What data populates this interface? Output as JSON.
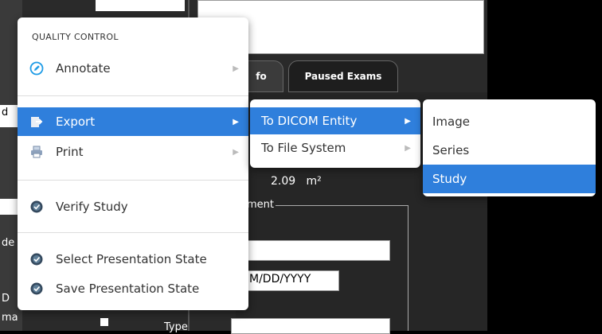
{
  "background": {
    "tabs": [
      {
        "label": "fo"
      },
      {
        "label": "Paused Exams"
      }
    ],
    "metric_value": "2.09",
    "metric_unit": "m²",
    "group_label": "ment",
    "date_placeholder": "M/DD/YYYY",
    "type_label": "Type",
    "left_fragments": [
      "d",
      "de",
      "D",
      "ma"
    ]
  },
  "context_menu": {
    "section_title": "QUALITY CONTROL",
    "items": [
      {
        "label": "Annotate",
        "icon": "annotate-icon",
        "has_submenu": true
      },
      {
        "label": "Export",
        "icon": "export-icon",
        "has_submenu": true,
        "highlighted": true
      },
      {
        "label": "Print",
        "icon": "printer-icon",
        "has_submenu": true
      },
      {
        "label": "Verify Study",
        "icon": "verify-icon",
        "has_submenu": false
      },
      {
        "label": "Select Presentation State",
        "icon": "presentation-icon",
        "has_submenu": false
      },
      {
        "label": "Save Presentation State",
        "icon": "presentation-icon",
        "has_submenu": false
      }
    ]
  },
  "export_submenu": {
    "items": [
      {
        "label": "To DICOM Entity",
        "has_submenu": true,
        "highlighted": true
      },
      {
        "label": "To File System",
        "has_submenu": true
      }
    ]
  },
  "dicom_submenu": {
    "items": [
      {
        "label": "Image"
      },
      {
        "label": "Series"
      },
      {
        "label": "Study",
        "highlighted": true
      }
    ]
  },
  "colors": {
    "highlight": "#2f7fdc",
    "menu_bg": "#ffffff",
    "app_bg": "#2a2a2a"
  }
}
